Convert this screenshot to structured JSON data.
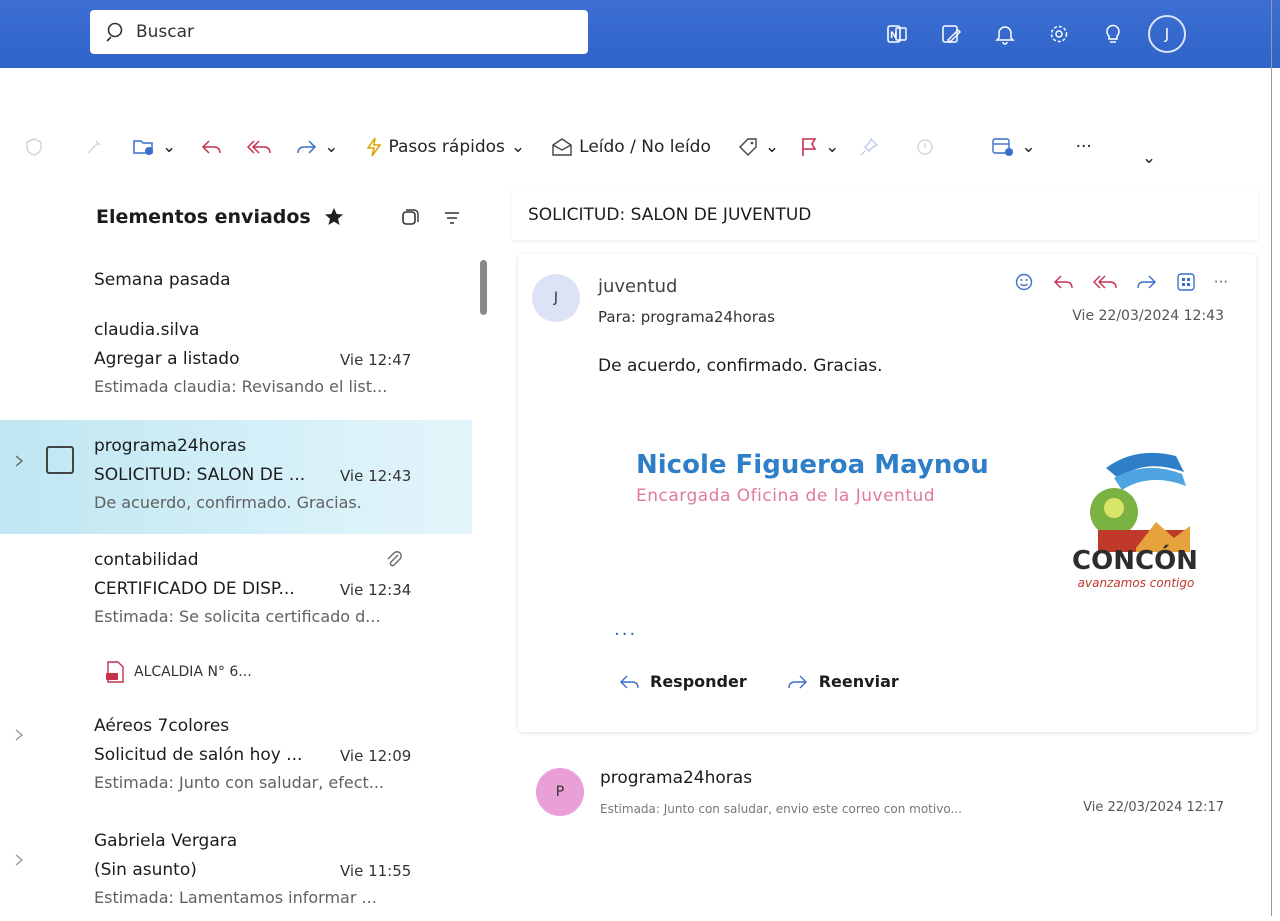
{
  "search": {
    "placeholder": "Buscar"
  },
  "top_icons": [
    "onenote-icon",
    "edit-note-icon",
    "bell-icon",
    "gear-icon",
    "lightbulb-icon"
  ],
  "user": {
    "initial": "J"
  },
  "ribbon": {
    "quick_steps": "Pasos rápidos",
    "read_unread": "Leído / No leído",
    "more": "···"
  },
  "folder": {
    "title": "Elementos enviados",
    "group": "Semana pasada"
  },
  "messages": [
    {
      "sender": "claudia.silva",
      "subject": "Agregar a listado",
      "time": "Vie 12:47",
      "preview": "Estimada claudia: Revisando el list..."
    },
    {
      "sender": "programa24horas",
      "subject": "SOLICITUD: SALON DE ...",
      "time": "Vie 12:43",
      "preview": "De acuerdo, confirmado. Gracias.",
      "selected": true
    },
    {
      "sender": "contabilidad",
      "subject": "CERTIFICADO DE DISP...",
      "time": "Vie 12:34",
      "preview": "Estimada: Se solicita certificado d...",
      "attachment": "ALCALDIA N° 6..."
    },
    {
      "sender": "Aéreos 7colores",
      "subject": "Solicitud de salón hoy ...",
      "time": "Vie 12:09",
      "preview": "Estimada: Junto con saludar, efect..."
    },
    {
      "sender": "Gabriela Vergara",
      "subject": "(Sin asunto)",
      "time": "Vie 11:55",
      "preview": "Estimada: Lamentamos informar ..."
    }
  ],
  "reading": {
    "subject": "SOLICITUD: SALON DE JUVENTUD",
    "msg1": {
      "avatar": "J",
      "from": "juventud",
      "to": "Para:  programa24horas",
      "date": "Vie 22/03/2024 12:43",
      "body": "De acuerdo, confirmado. Gracias.",
      "signature_name": "Nicole Figueroa Maynou",
      "signature_role": "Encargada Oficina de la Juventud",
      "logo_word": "CONCÓN",
      "logo_tag": "avanzamos contigo",
      "more": "···",
      "reply": "Responder",
      "forward": "Reenviar"
    },
    "msg2": {
      "avatar": "P",
      "from": "programa24horas",
      "preview": "Estimada: Junto con saludar, envio este correo con motivo...",
      "date": "Vie 22/03/2024 12:17"
    }
  },
  "colors": {
    "topbar": "#2f63c8",
    "selected_row": "#c6eaf4",
    "accent_red": "#c4314b",
    "accent_blue": "#2f63c8"
  }
}
